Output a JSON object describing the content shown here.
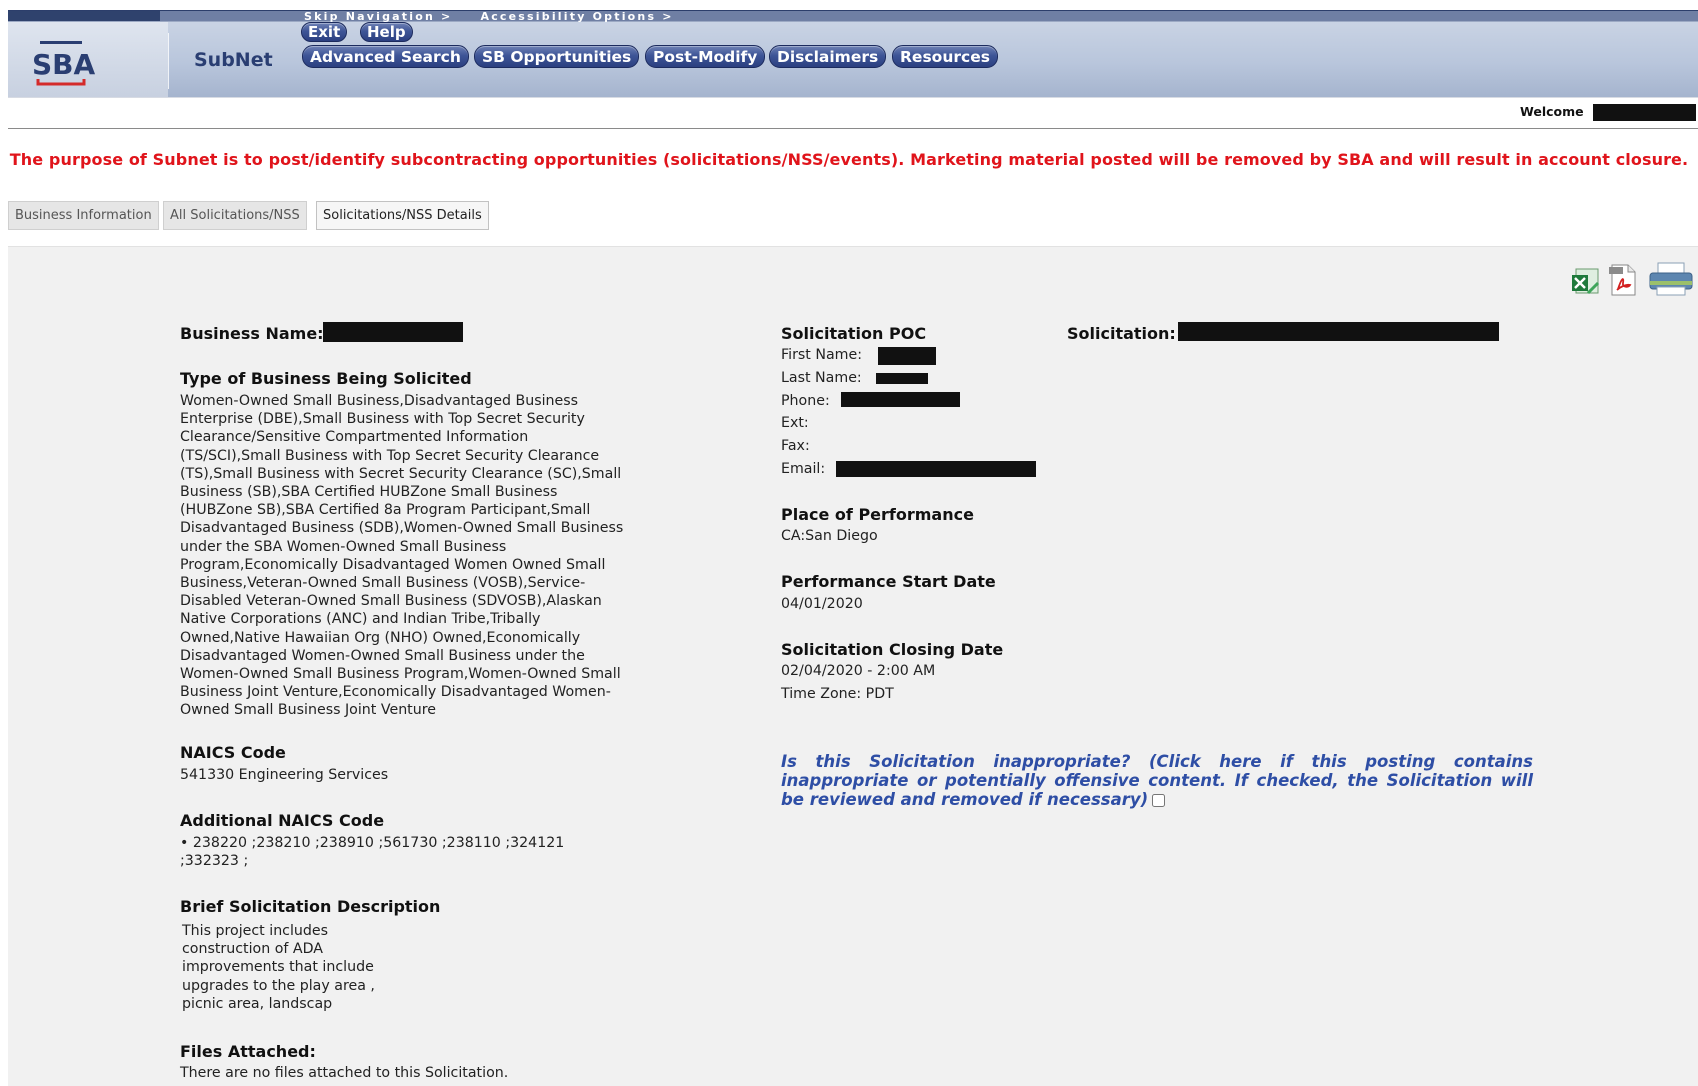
{
  "header": {
    "logo_text": "SBA",
    "app_name": "SubNet",
    "skip_links": [
      "Skip Navigation >",
      "Accessibility Options >"
    ],
    "small_buttons": [
      "Exit",
      "Help"
    ],
    "nav_buttons": [
      "Advanced Search",
      "SB Opportunities",
      "Post-Modify",
      "Disclaimers",
      "Resources"
    ],
    "welcome_label": "Welcome"
  },
  "notice": "The purpose of Subnet is to post/identify subcontracting opportunities (solicitations/NSS/events). Marketing material posted will be removed by SBA and will result in account closure.",
  "tabs": [
    "Business Information",
    "All Solicitations/NSS",
    "Solicitations/NSS Details"
  ],
  "toolbar_icons": [
    "excel-export-icon",
    "pdf-export-icon",
    "print-icon"
  ],
  "left": {
    "business_name_label": "Business Name:",
    "type_heading": "Type of Business Being Solicited",
    "type_lines": [
      "Women-Owned Small Business,Disadvantaged Business",
      "Enterprise (DBE),Small Business with Top Secret Security",
      "Clearance/Sensitive Compartmented Information",
      "(TS/SCI),Small Business with Top Secret Security Clearance",
      "(TS),Small Business with Secret Security Clearance (SC),Small",
      "Business (SB),SBA Certified HUBZone Small Business",
      "(HUBZone SB),SBA Certified 8a Program Participant,Small",
      "Disadvantaged Business (SDB),Women-Owned Small Business",
      "under the SBA Women-Owned Small Business",
      "Program,Economically Disadvantaged Women Owned Small",
      "Business,Veteran-Owned Small Business (VOSB),Service-",
      "Disabled Veteran-Owned Small Business (SDVOSB),Alaskan",
      "Native Corporations (ANC) and Indian Tribe,Tribally",
      "Owned,Native Hawaiian Org (NHO) Owned,Economically",
      "Disadvantaged Women-Owned Small Business under the",
      "Women-Owned Small Business Program,Women-Owned Small",
      "Business Joint Venture,Economically Disadvantaged Women-",
      "Owned Small Business Joint Venture"
    ],
    "naics_heading": "NAICS Code",
    "naics_value": "541330 Engineering Services",
    "add_naics_heading": "Additional NAICS Code",
    "add_naics_line1": "• 238220 ;238210 ;238910 ;561730 ;238110 ;324121",
    "add_naics_line2": ";332323 ;",
    "desc_heading": "Brief Solicitation Description",
    "desc_lines": [
      "This project includes",
      "construction of ADA",
      "improvements that include",
      "upgrades to the play area ,",
      "picnic area, landscap"
    ],
    "files_heading": "Files Attached:",
    "files_value": "There are no files attached to this Solicitation."
  },
  "middle": {
    "poc_heading": "Solicitation POC",
    "first_name_label": "First Name:",
    "last_name_label": "Last Name:",
    "phone_label": "Phone:",
    "ext_label": "Ext:",
    "fax_label": "Fax:",
    "email_label": "Email:",
    "place_heading": "Place of Performance",
    "place_value": "CA:San Diego",
    "start_heading": "Performance Start Date",
    "start_value": "04/01/2020",
    "closing_heading": "Solicitation Closing Date",
    "closing_value": "02/04/2020 - 2:00 AM",
    "timezone": "Time Zone: PDT",
    "flag_text": "Is this Solicitation inappropriate? (Click here if this posting contains inappropriate or potentially offensive content. If checked, the Solicitation will be reviewed and removed if necessary)"
  },
  "right": {
    "solicitation_label": "Solicitation:"
  },
  "colors": {
    "notice_red": "#e0141b",
    "nav_blue": "#2b3f80",
    "flag_blue": "#2e4ea5",
    "panel_gray": "#f1f1f1"
  }
}
